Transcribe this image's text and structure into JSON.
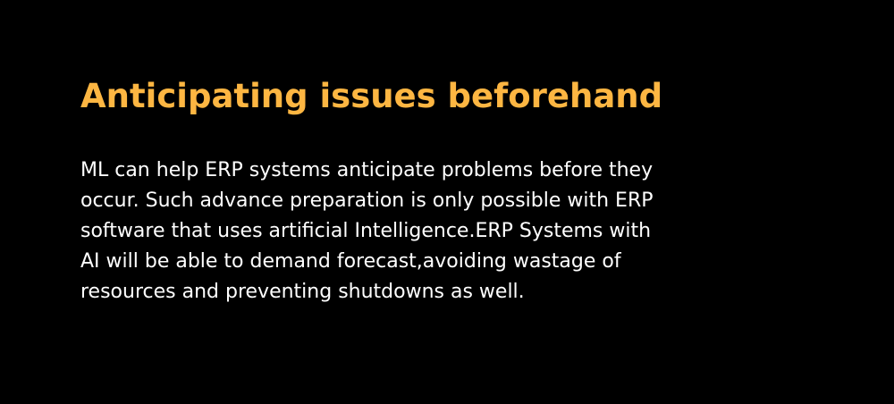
{
  "heading": "Anticipating issues beforehand",
  "paragraph_lines": [
    "ML can help ERP systems anticipate problems before they",
    "occur. Such advance preparation is only possible with ERP",
    "software that uses artificial Intelligence.ERP Systems with",
    "AI will be able to demand forecast,avoiding wastage of",
    "resources and preventing shutdowns as well."
  ],
  "colors": {
    "background": "#000000",
    "heading": "#FDB642",
    "text": "#FFFFFF"
  }
}
